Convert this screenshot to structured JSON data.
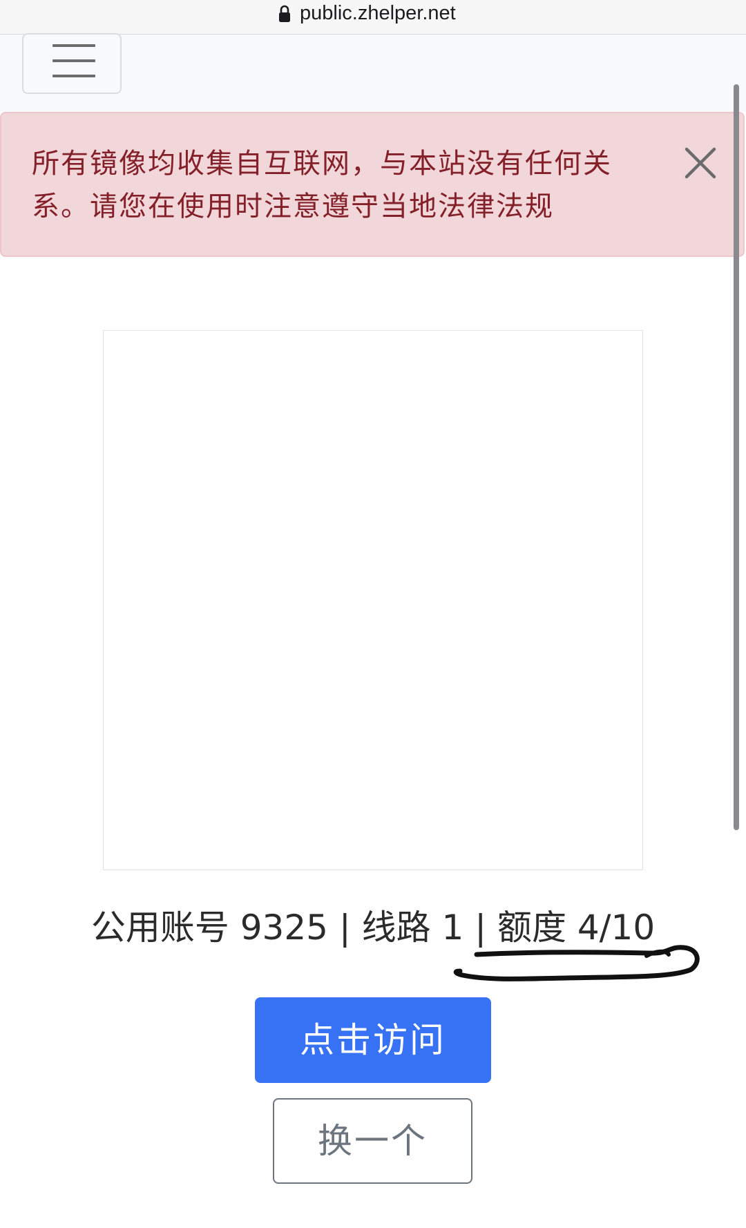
{
  "browser": {
    "url": "public.zhelper.net"
  },
  "alert": {
    "message": "所有镜像均收集自互联网，与本站没有任何关系。请您在使用时注意遵守当地法律法规"
  },
  "account": {
    "info": "公用账号 9325 | 线路 1 | 额度 4/10"
  },
  "buttons": {
    "visit_label": "点击访问",
    "switch_label": "换一个"
  }
}
